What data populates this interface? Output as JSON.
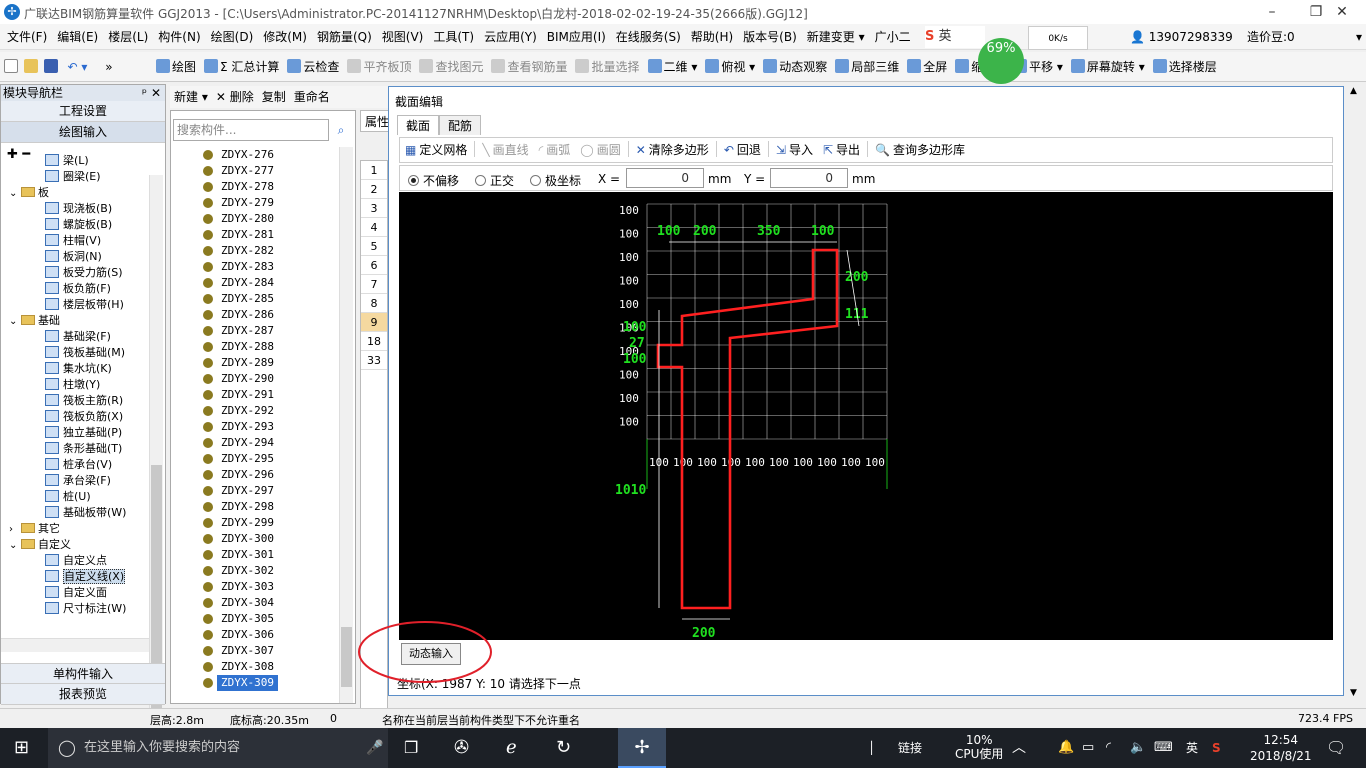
{
  "window": {
    "title": "广联达BIM钢筋算量软件 GGJ2013 - [C:\\Users\\Administrator.PC-20141127NRHM\\Desktop\\白龙村-2018-02-02-19-24-35(2666版).GGJ12]",
    "minimize": "–",
    "restore": "❐",
    "close": "✕"
  },
  "menu": [
    "文件(F)",
    "编辑(E)",
    "楼层(L)",
    "构件(N)",
    "绘图(D)",
    "修改(M)",
    "钢筋量(Q)",
    "视图(V)",
    "工具(T)",
    "云应用(Y)",
    "BIM应用(I)",
    "在线服务(S)",
    "帮助(H)",
    "版本号(B)",
    "新建变更 ▾",
    "广小二"
  ],
  "menu_right": {
    "ime": "英",
    "phone": "13907298339",
    "price": "造价豆:0"
  },
  "perf": {
    "percent": "69%",
    "net": "0K/s"
  },
  "toolbar": [
    "绘图",
    "Σ 汇总计算",
    "云检查",
    "平齐板顶",
    "查找图元",
    "查看钢筋量",
    "批量选择",
    "二维 ▾",
    "俯视 ▾",
    "动态观察",
    "局部三维",
    "全屏",
    "缩放 ▾",
    "平移 ▾",
    "屏幕旋转 ▾",
    "选择楼层"
  ],
  "toolbar_disabled": [
    3,
    4,
    5,
    6
  ],
  "nav": {
    "header": "模块导航栏",
    "pin": "ᵖ",
    "close": "✕",
    "btn_project": "工程设置",
    "btn_draw": "绘图输入",
    "btn_single": "单构件输入",
    "btn_report": "报表预览",
    "tree": [
      {
        "indent": 2,
        "icon": "node",
        "label": "梁(L)"
      },
      {
        "indent": 2,
        "icon": "node",
        "label": "圈梁(E)"
      },
      {
        "indent": 1,
        "icon": "folder",
        "label": "板",
        "exp": "⌄"
      },
      {
        "indent": 2,
        "icon": "node",
        "label": "现浇板(B)"
      },
      {
        "indent": 2,
        "icon": "node",
        "label": "螺旋板(B)"
      },
      {
        "indent": 2,
        "icon": "node",
        "label": "柱帽(V)"
      },
      {
        "indent": 2,
        "icon": "node",
        "label": "板洞(N)"
      },
      {
        "indent": 2,
        "icon": "node",
        "label": "板受力筋(S)"
      },
      {
        "indent": 2,
        "icon": "node",
        "label": "板负筋(F)"
      },
      {
        "indent": 2,
        "icon": "node",
        "label": "楼层板带(H)"
      },
      {
        "indent": 1,
        "icon": "folder",
        "label": "基础",
        "exp": "⌄"
      },
      {
        "indent": 2,
        "icon": "node",
        "label": "基础梁(F)"
      },
      {
        "indent": 2,
        "icon": "node",
        "label": "筏板基础(M)"
      },
      {
        "indent": 2,
        "icon": "node",
        "label": "集水坑(K)"
      },
      {
        "indent": 2,
        "icon": "node",
        "label": "柱墩(Y)"
      },
      {
        "indent": 2,
        "icon": "node",
        "label": "筏板主筋(R)"
      },
      {
        "indent": 2,
        "icon": "node",
        "label": "筏板负筋(X)"
      },
      {
        "indent": 2,
        "icon": "node",
        "label": "独立基础(P)"
      },
      {
        "indent": 2,
        "icon": "node",
        "label": "条形基础(T)"
      },
      {
        "indent": 2,
        "icon": "node",
        "label": "桩承台(V)"
      },
      {
        "indent": 2,
        "icon": "node",
        "label": "承台梁(F)"
      },
      {
        "indent": 2,
        "icon": "node",
        "label": "桩(U)"
      },
      {
        "indent": 2,
        "icon": "node",
        "label": "基础板带(W)"
      },
      {
        "indent": 1,
        "icon": "folder",
        "label": "其它",
        "exp": "›"
      },
      {
        "indent": 1,
        "icon": "folder",
        "label": "自定义",
        "exp": "⌄"
      },
      {
        "indent": 2,
        "icon": "node",
        "label": "自定义点"
      },
      {
        "indent": 2,
        "icon": "node",
        "label": "自定义线(X)",
        "sel": true
      },
      {
        "indent": 2,
        "icon": "node",
        "label": "自定义面"
      },
      {
        "indent": 2,
        "icon": "node",
        "label": "尺寸标注(W)"
      }
    ]
  },
  "complist": {
    "toolbar": [
      "新建 ▾",
      "✕ 删除",
      "复制",
      "重命名"
    ],
    "search_placeholder": "搜索构件...",
    "items": [
      "ZDYX-276",
      "ZDYX-277",
      "ZDYX-278",
      "ZDYX-279",
      "ZDYX-280",
      "ZDYX-281",
      "ZDYX-282",
      "ZDYX-283",
      "ZDYX-284",
      "ZDYX-285",
      "ZDYX-286",
      "ZDYX-287",
      "ZDYX-288",
      "ZDYX-289",
      "ZDYX-290",
      "ZDYX-291",
      "ZDYX-292",
      "ZDYX-293",
      "ZDYX-294",
      "ZDYX-295",
      "ZDYX-296",
      "ZDYX-297",
      "ZDYX-298",
      "ZDYX-299",
      "ZDYX-300",
      "ZDYX-301",
      "ZDYX-302",
      "ZDYX-303",
      "ZDYX-304",
      "ZDYX-305",
      "ZDYX-306",
      "ZDYX-307",
      "ZDYX-308",
      "ZDYX-309"
    ],
    "selected_index": 33
  },
  "props": {
    "label": "属性",
    "rows": [
      "1",
      "2",
      "3",
      "4",
      "5",
      "6",
      "7",
      "8",
      "9",
      "18",
      "33"
    ],
    "highlight": 8
  },
  "dialog": {
    "title": "截面编辑",
    "tabs": [
      "截面",
      "配筋"
    ],
    "tools": [
      "定义网格",
      "画直线",
      "画弧",
      "画圆",
      "清除多边形",
      "回退",
      "导入",
      "导出",
      "查询多边形库"
    ],
    "tools_disabled": [
      1,
      2,
      3
    ],
    "radio": [
      "不偏移",
      "正交",
      "极坐标"
    ],
    "x_label": "X =",
    "x_value": "0",
    "y_label": "Y =",
    "y_value": "0",
    "unit": "mm",
    "dynamic_input": "动态输入",
    "status_coord": "坐标(X: 1987 Y: 10",
    "status_msg": "请选择下一点"
  },
  "grid": {
    "left_labels": [
      "100",
      "100",
      "100",
      "100",
      "100",
      "100",
      "100",
      "100",
      "100",
      "100"
    ],
    "bottom_labels": [
      "100",
      "100",
      "100",
      "100",
      "100",
      "100",
      "100",
      "100",
      "100",
      "100"
    ],
    "dims": {
      "top1": "100",
      "top2": "200",
      "top3": "350",
      "top4": "100",
      "right1": "200",
      "right2": "111",
      "left1": "100",
      "left2": "27",
      "left3": "100",
      "height": "1010",
      "bottom": "200"
    }
  },
  "statusbar": {
    "floor_h": "层高:2.8m",
    "bottom_h": "底标高:20.35m",
    "val": "0",
    "msg": "名称在当前层当前构件类型下不允许重名",
    "fps": "723.4 FPS"
  },
  "taskbar": {
    "search": "在这里输入你要搜索的内容",
    "link": "链接",
    "cpu_pct": "10%",
    "cpu_label": "CPU使用",
    "ime": "英",
    "time": "12:54",
    "date": "2018/8/21"
  },
  "colors": {
    "shape": "#ff2020",
    "dim": "#20e020",
    "grid": "#ffffff",
    "accent": "#3072d0",
    "annot": "#e0202a"
  }
}
